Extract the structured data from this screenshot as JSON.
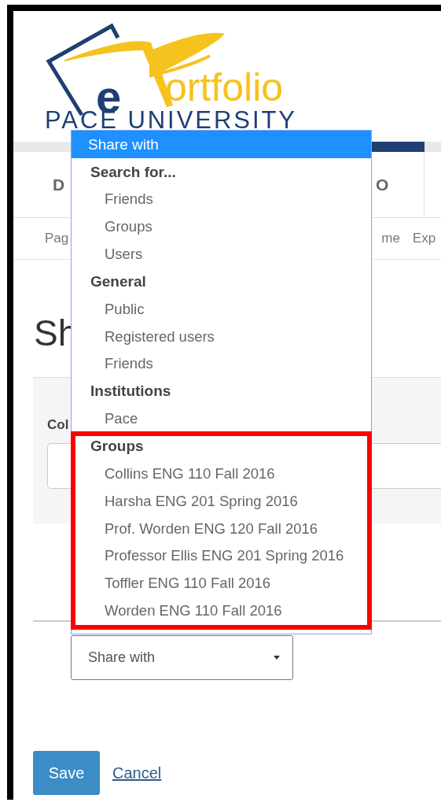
{
  "logo": {
    "letter": "e",
    "word": "ortfolio",
    "subtitle": "PACE UNIVERSITY"
  },
  "nav_tabs": [
    {
      "label": "D",
      "selected": false
    },
    {
      "label": "O",
      "selected": false
    }
  ],
  "sub_nav": [
    {
      "label": "Pag"
    },
    {
      "label": "me"
    },
    {
      "label": "Exp"
    }
  ],
  "heading": "Sh",
  "panel": {
    "label": "Col"
  },
  "share_select": {
    "value": "Share with"
  },
  "dropdown": {
    "current": {
      "label": "Share with",
      "selected": true
    },
    "groups": [
      {
        "label": "Search for...",
        "options": [
          {
            "label": "Friends",
            "selected": false
          },
          {
            "label": "Groups",
            "selected": false
          },
          {
            "label": "Users",
            "selected": false
          }
        ]
      },
      {
        "label": "General",
        "options": [
          {
            "label": "Public",
            "selected": false
          },
          {
            "label": "Registered users",
            "selected": false
          },
          {
            "label": "Friends",
            "selected": false
          }
        ]
      },
      {
        "label": "Institutions",
        "options": [
          {
            "label": "Pace",
            "selected": false
          }
        ]
      },
      {
        "label": "Groups",
        "highlighted": true,
        "options": [
          {
            "label": "Collins ENG 110 Fall 2016",
            "selected": false
          },
          {
            "label": "Harsha ENG 201 Spring 2016",
            "selected": false
          },
          {
            "label": "Prof. Worden ENG 120 Fall 2016",
            "selected": false
          },
          {
            "label": "Professor Ellis ENG 201 Spring 2016",
            "selected": false
          },
          {
            "label": "Toffler ENG 110 Fall 2016",
            "selected": false
          },
          {
            "label": "Worden ENG 110 Fall 2016",
            "selected": false
          }
        ]
      }
    ]
  },
  "buttons": {
    "save": "Save",
    "cancel": "Cancel"
  }
}
